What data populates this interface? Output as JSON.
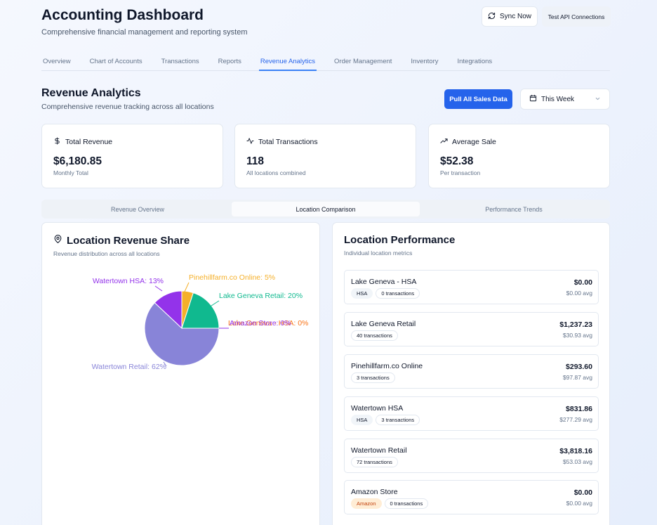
{
  "header": {
    "title": "Accounting Dashboard",
    "subtitle": "Comprehensive financial management and reporting system",
    "sync_label": "Sync Now",
    "test_api_label": "Test API Connections"
  },
  "nav": {
    "items": [
      "Overview",
      "Chart of Accounts",
      "Transactions",
      "Reports",
      "Revenue Analytics",
      "Order Management",
      "Inventory",
      "Integrations"
    ],
    "active": "Revenue Analytics"
  },
  "section": {
    "title": "Revenue Analytics",
    "subtitle": "Comprehensive revenue tracking across all locations",
    "pull_label": "Pull All Sales Data",
    "period_value": "This Week"
  },
  "stats": [
    {
      "label": "Total Revenue",
      "value": "$6,180.85",
      "caption": "Monthly Total",
      "icon": "dollar-icon"
    },
    {
      "label": "Total Transactions",
      "value": "118",
      "caption": "All locations combined",
      "icon": "activity-icon"
    },
    {
      "label": "Average Sale",
      "value": "$52.38",
      "caption": "Per transaction",
      "icon": "trending-up-icon"
    }
  ],
  "tabs": [
    "Revenue Overview",
    "Location Comparison",
    "Performance Trends"
  ],
  "active_tab": "Location Comparison",
  "share_panel": {
    "title": "Location Revenue Share",
    "subtitle": "Revenue distribution across all locations"
  },
  "chart_data": {
    "type": "pie",
    "slices": [
      {
        "label": "Watertown Retail: 62%",
        "name": "Watertown Retail",
        "value": 62,
        "color": "#8884d8"
      },
      {
        "label": "Watertown HSA: 13%",
        "name": "Watertown HSA",
        "value": 13,
        "color": "#9333ea"
      },
      {
        "label": "Pinehillfarm.co Online: 5%",
        "name": "Pinehillfarm.co Online",
        "value": 5,
        "color": "#f5b02a"
      },
      {
        "label": "Lake Geneva Retail: 20%",
        "name": "Lake Geneva Retail",
        "value": 20,
        "color": "#10b98f"
      },
      {
        "label": "Lake Geneva - HSA: 0%",
        "name": "Lake Geneva - HSA",
        "value": 0,
        "color": "#f97316"
      },
      {
        "label": "Amazon Store: 0%",
        "name": "Amazon Store",
        "value": 0,
        "color": "#9333ea"
      }
    ]
  },
  "performance_panel": {
    "title": "Location Performance",
    "subtitle": "Individual location metrics",
    "locations": [
      {
        "name": "Lake Geneva - HSA",
        "tags": [
          "HSA"
        ],
        "transactions": "0 transactions",
        "amount": "$0.00",
        "avg": "$0.00 avg"
      },
      {
        "name": "Lake Geneva Retail",
        "tags": [],
        "transactions": "40 transactions",
        "amount": "$1,237.23",
        "avg": "$30.93 avg"
      },
      {
        "name": "Pinehillfarm.co Online",
        "tags": [],
        "transactions": "3 transactions",
        "amount": "$293.60",
        "avg": "$97.87 avg"
      },
      {
        "name": "Watertown HSA",
        "tags": [
          "HSA"
        ],
        "transactions": "3 transactions",
        "amount": "$831.86",
        "avg": "$277.29 avg"
      },
      {
        "name": "Watertown Retail",
        "tags": [],
        "transactions": "72 transactions",
        "amount": "$3,818.16",
        "avg": "$53.03 avg"
      },
      {
        "name": "Amazon Store",
        "tags": [
          "Amazon"
        ],
        "transactions": "0 transactions",
        "amount": "$0.00",
        "avg": "$0.00 avg"
      }
    ]
  }
}
